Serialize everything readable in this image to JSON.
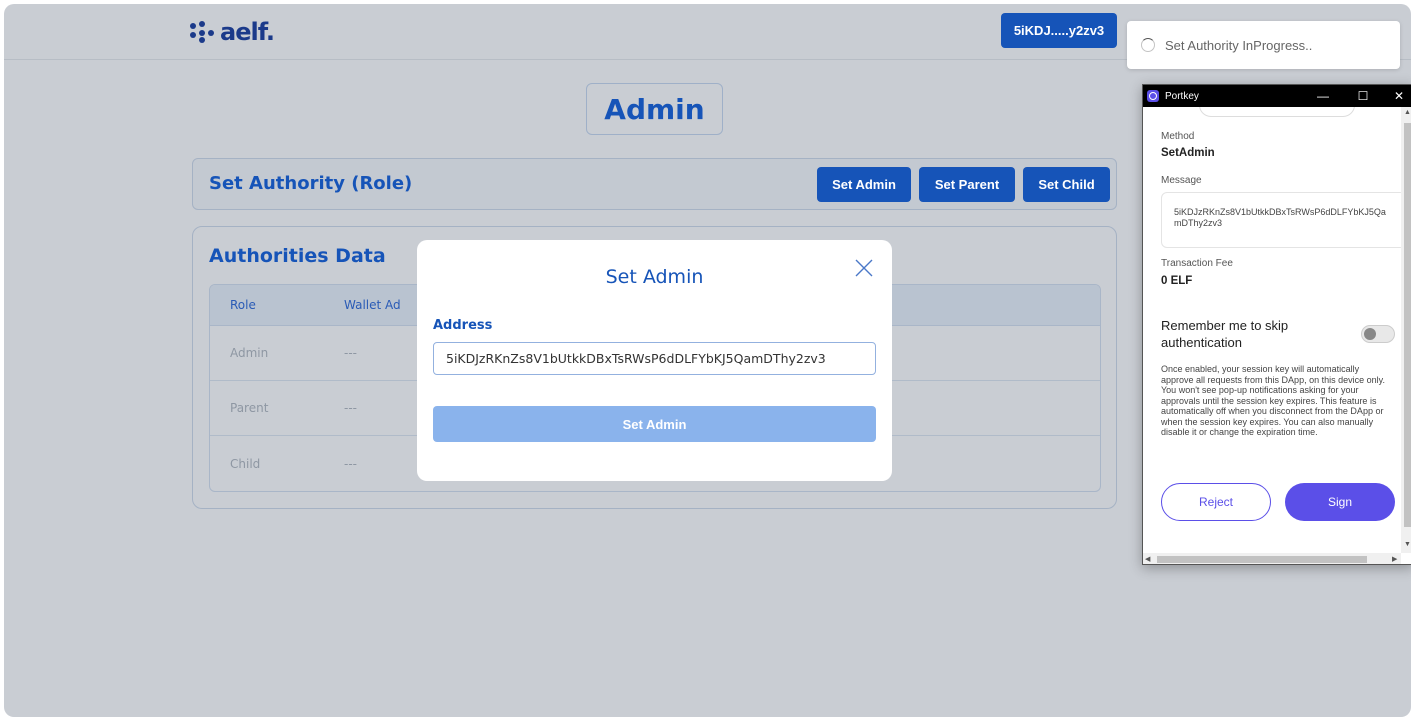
{
  "app": {
    "logo_text": "aelf.",
    "wallet_address": "5iKDJ.....y2zv3",
    "page_title": "Admin",
    "set_authority": {
      "title": "Set Authority (Role)",
      "buttons": [
        "Set Admin",
        "Set Parent",
        "Set Child"
      ]
    },
    "authorities": {
      "title": "Authorities Data",
      "columns": [
        "Role",
        "Wallet Ad"
      ],
      "rows": [
        {
          "role": "Admin",
          "wallet": "---"
        },
        {
          "role": "Parent",
          "wallet": "---"
        },
        {
          "role": "Child",
          "wallet": "---"
        }
      ]
    }
  },
  "modal": {
    "title": "Set Admin",
    "address_label": "Address",
    "address_value": "5iKDJzRKnZs8V1bUtkkDBxTsRWsP6dDLFYbKJ5QamDThy2zv3",
    "submit_label": "Set Admin"
  },
  "toast": {
    "text": "Set Authority InProgress.."
  },
  "portkey": {
    "window_title": "Portkey",
    "controls": [
      "—",
      "☐",
      "✕"
    ],
    "method_label": "Method",
    "method_value": "SetAdmin",
    "message_label": "Message",
    "message_value": "5iKDJzRKnZs8V1bUtkkDBxTsRWsP6dDLFYbKJ5QamDThy2zv3",
    "fee_label": "Transaction Fee",
    "fee_value": "0 ELF",
    "remember_label": "Remember me to skip authentication",
    "remember_enabled": false,
    "description": "Once enabled, your session key will automatically approve all requests from this DApp, on this device only. You won't see pop-up notifications asking for your approvals until the session key expires. This feature is automatically off when you disconnect from the DApp or when the session key expires. You can also manually disable it or change the expiration time.",
    "reject_label": "Reject",
    "sign_label": "Sign"
  }
}
